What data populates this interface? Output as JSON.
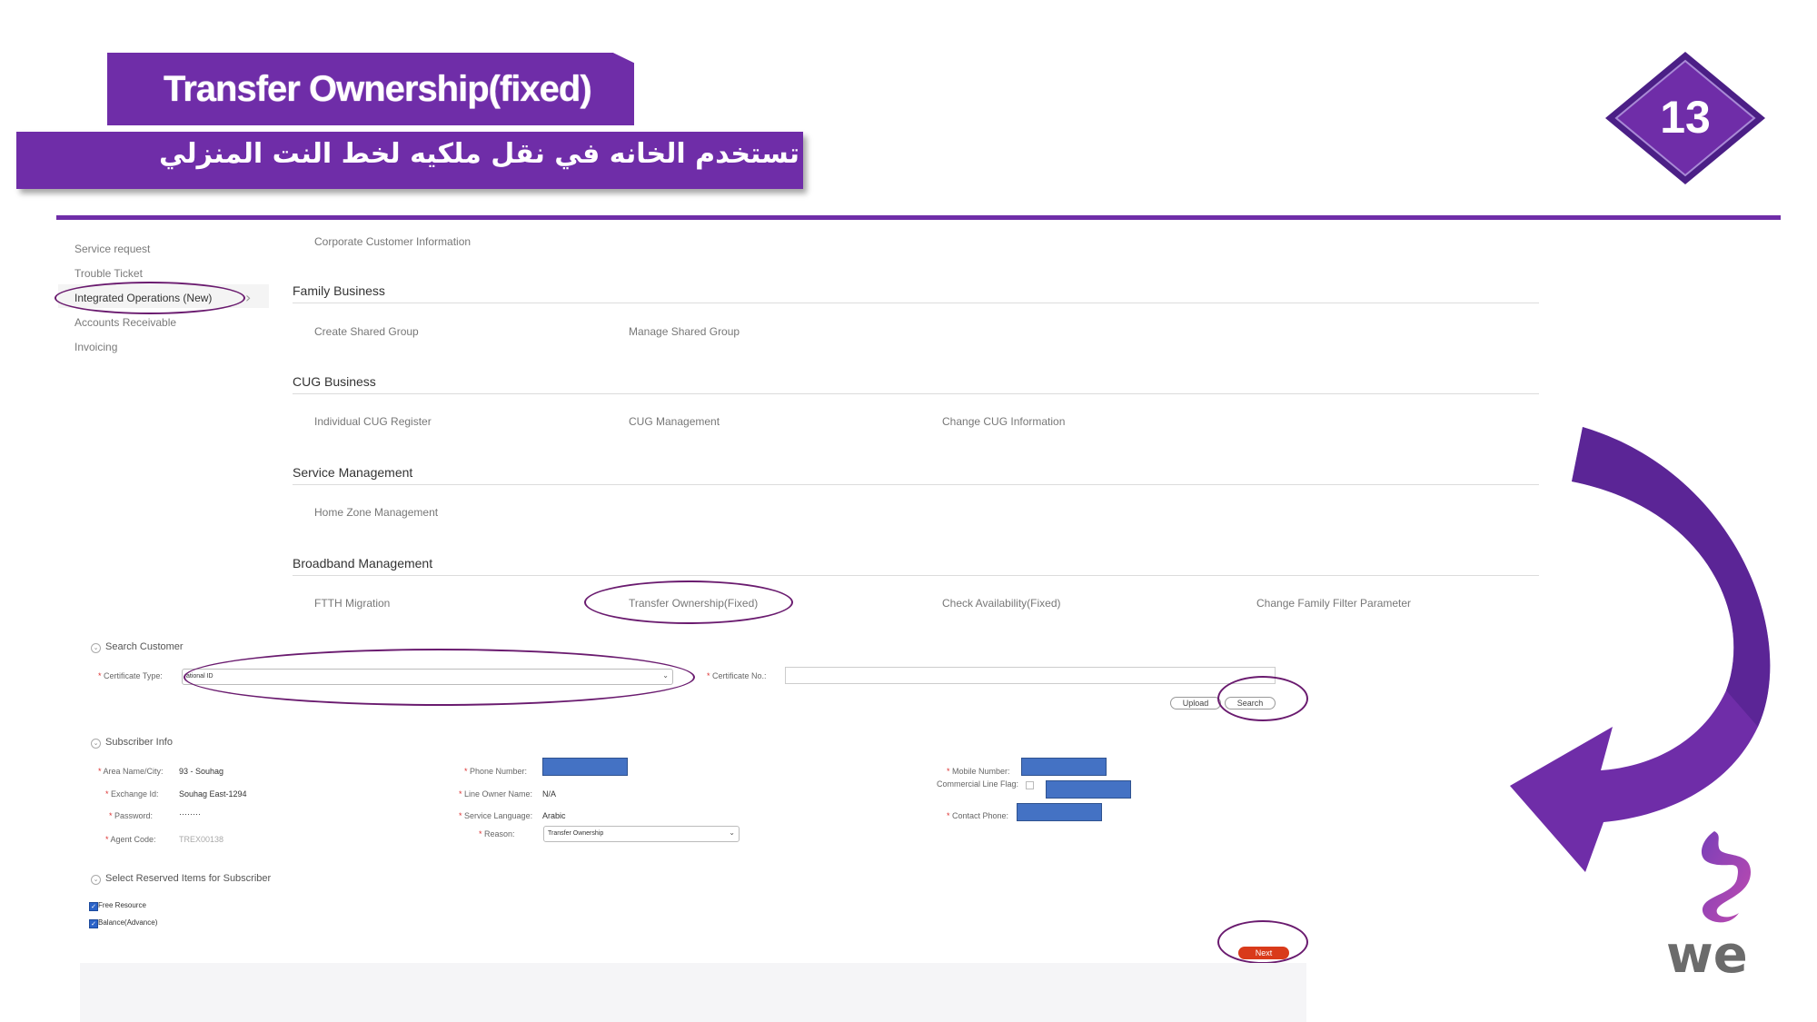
{
  "slide": {
    "title": "Transfer Ownership(fixed)",
    "subtitle": "تستخدم الخانه في نقل ملكيه لخط النت المنزلي",
    "step_number": "13",
    "accent_color": "#6f2da8"
  },
  "nav": {
    "items": [
      {
        "label": "Service request"
      },
      {
        "label": "Trouble Ticket"
      },
      {
        "label": "Integrated Operations (New)",
        "active": true
      },
      {
        "label": "Accounts Receivable"
      },
      {
        "label": "Invoicing"
      }
    ]
  },
  "sections": {
    "corporate": {
      "link": "Corporate Customer Information"
    },
    "family": {
      "title": "Family Business",
      "links": [
        "Create Shared Group",
        "Manage Shared Group"
      ]
    },
    "cug": {
      "title": "CUG Business",
      "links": [
        "Individual CUG Register",
        "CUG Management",
        "Change CUG Information"
      ]
    },
    "service": {
      "title": "Service Management",
      "links": [
        "Home Zone Management"
      ]
    },
    "broadband": {
      "title": "Broadband Management",
      "links": [
        "FTTH Migration",
        "Transfer Ownership(Fixed)",
        "Check Availability(Fixed)",
        "Change Family Filter Parameter"
      ]
    }
  },
  "search": {
    "header": "Search Customer",
    "cert_type_label": "Certificate Type:",
    "cert_type_value": "ational ID",
    "cert_no_label": "Certificate No.:",
    "upload_label": "Upload",
    "search_label": "Search"
  },
  "subscriber": {
    "header": "Subscriber Info",
    "area_label": "Area Name/City:",
    "area_value": "93 - Souhag",
    "exchange_label": "Exchange Id:",
    "exchange_value": "Souhag East-1294",
    "password_label": "Password:",
    "password_value": "········",
    "agent_label": "Agent Code:",
    "agent_value": "TREX00138",
    "phone_label": "Phone Number:",
    "owner_label": "Line Owner Name:",
    "owner_value": "N/A",
    "language_label": "Service Language:",
    "language_value": "Arabic",
    "reason_label": "Reason:",
    "reason_value": "Transfer Ownership",
    "mobile_label": "Mobile Number:",
    "commercial_label": "Commercial Line Flag:",
    "contact_label": "Contact Phone:"
  },
  "reserved": {
    "header": "Select Reserved Items for Subscriber",
    "items": [
      "Free Resource",
      "Balance(Advance)"
    ]
  },
  "next_label": "Next",
  "logo": {
    "text": "we"
  }
}
